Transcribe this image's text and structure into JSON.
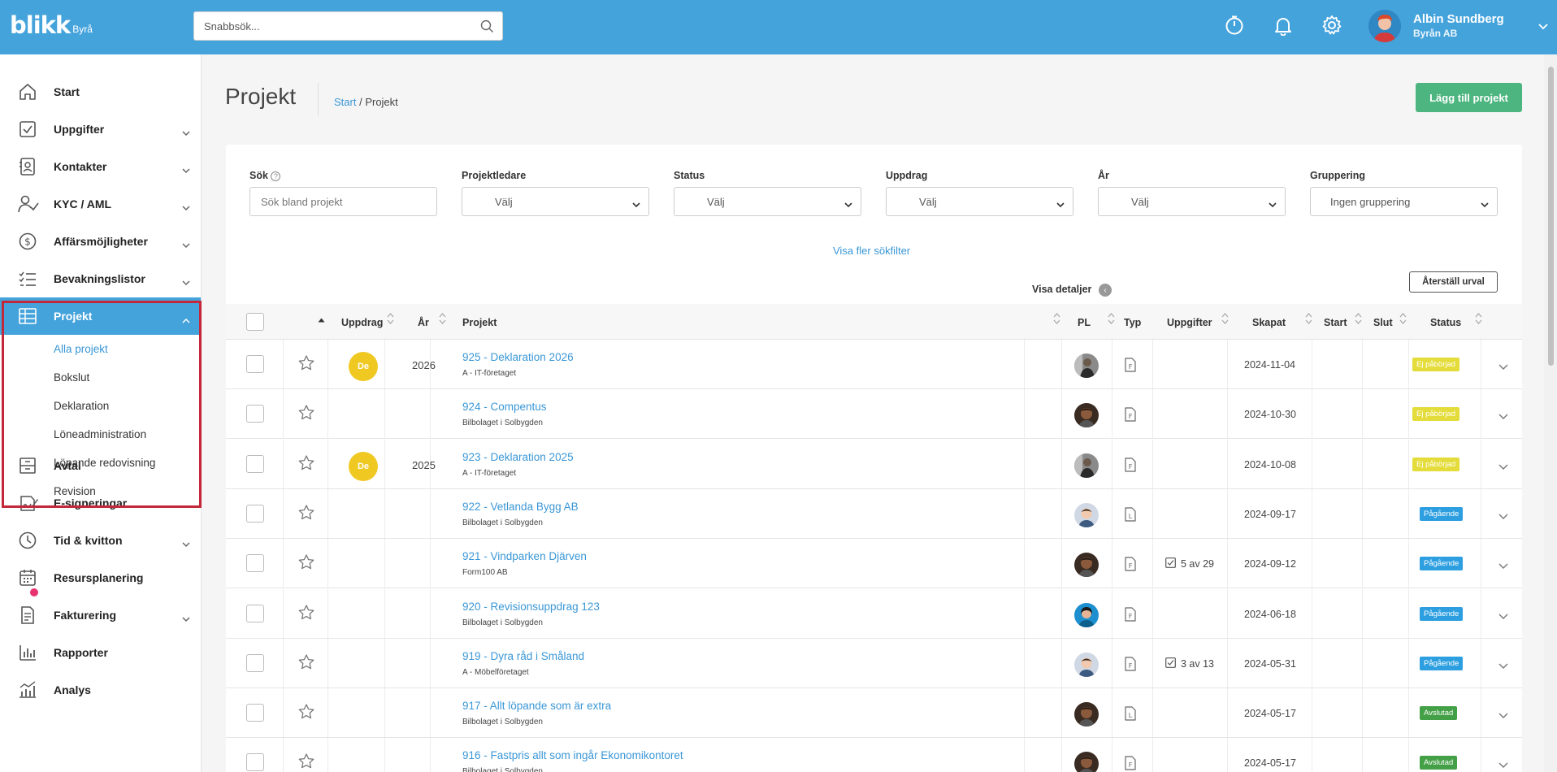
{
  "app": {
    "logo": "blikk",
    "logo_sub": "Byrå"
  },
  "header": {
    "search_placeholder": "Snabbsök...",
    "icons": [
      "stopwatch-icon",
      "bell-icon",
      "gear-icon"
    ],
    "user_name": "Albin Sundberg",
    "user_company": "Byrån AB"
  },
  "sidebar": {
    "items": [
      {
        "label": "Start",
        "icon": "home-icon",
        "chevron": false
      },
      {
        "label": "Uppgifter",
        "icon": "checkbox-icon",
        "chevron": true
      },
      {
        "label": "Kontakter",
        "icon": "contacts-icon",
        "chevron": true
      },
      {
        "label": "KYC / AML",
        "icon": "user-check-icon",
        "chevron": true
      },
      {
        "label": "Affärsmöjligheter",
        "icon": "dollar-icon",
        "chevron": true
      },
      {
        "label": "Bevakningslistor",
        "icon": "checklist-icon",
        "chevron": true
      },
      {
        "label": "Projekt",
        "icon": "table-icon",
        "chevron": true,
        "active": true
      },
      {
        "label": "Avtal",
        "icon": "archive-icon",
        "chevron": false
      },
      {
        "label": "E-signeringar",
        "icon": "signature-icon",
        "chevron": false
      },
      {
        "label": "Tid & kvitton",
        "icon": "clock-icon",
        "chevron": true
      },
      {
        "label": "Resursplanering",
        "icon": "calendar-icon",
        "chevron": false
      },
      {
        "label": "Fakturering",
        "icon": "invoice-icon",
        "chevron": true
      },
      {
        "label": "Rapporter",
        "icon": "bar-chart-icon",
        "chevron": false
      },
      {
        "label": "Analys",
        "icon": "analytics-icon",
        "chevron": false
      }
    ],
    "projekt_sub": [
      "Alla projekt",
      "Bokslut",
      "Deklaration",
      "Löneadministration",
      "Löpande redovisning",
      "Revision"
    ]
  },
  "page": {
    "title": "Projekt",
    "breadcrumb_link": "Start",
    "breadcrumb_sep": " / ",
    "breadcrumb_current": "Projekt",
    "add_button": "Lägg till projekt"
  },
  "filters": {
    "search_label": "Sök",
    "search_placeholder": "Sök bland projekt",
    "projektledare_label": "Projektledare",
    "projektledare_value": "Välj",
    "status_label": "Status",
    "status_value": "Välj",
    "uppdrag_label": "Uppdrag",
    "uppdrag_value": "Välj",
    "ar_label": "År",
    "ar_value": "Välj",
    "gruppering_label": "Gruppering",
    "gruppering_value": "Ingen gruppering",
    "more_filters": "Visa fler sökfilter",
    "show_details": "Visa detaljer",
    "reset": "Återställ urval"
  },
  "table": {
    "headers": {
      "uppdrag": "Uppdrag",
      "ar": "År",
      "projekt": "Projekt",
      "pl": "PL",
      "typ": "Typ",
      "uppgifter": "Uppgifter",
      "skapat": "Skapat",
      "start": "Start",
      "slut": "Slut",
      "status": "Status"
    },
    "rows": [
      {
        "uppdrag": "De",
        "year": "2026",
        "name": "925 - Deklaration 2026",
        "client": "A - IT-företaget",
        "typ": "F",
        "tasks": "",
        "created": "2024-11-04",
        "status": "Ej påbörjad",
        "status_type": "notstarted",
        "pl": "pl-a"
      },
      {
        "uppdrag": "",
        "year": "",
        "name": "924 - Compentus",
        "client": "Bilbolaget i Solbygden",
        "typ": "F",
        "tasks": "",
        "created": "2024-10-30",
        "status": "Ej påbörjad",
        "status_type": "notstarted",
        "pl": "pl-b"
      },
      {
        "uppdrag": "De",
        "year": "2025",
        "name": "923 - Deklaration 2025",
        "client": "A - IT-företaget",
        "typ": "F",
        "tasks": "",
        "created": "2024-10-08",
        "status": "Ej påbörjad",
        "status_type": "notstarted",
        "pl": "pl-a"
      },
      {
        "uppdrag": "",
        "year": "",
        "name": "922 - Vetlanda Bygg AB",
        "client": "Bilbolaget i Solbygden",
        "typ": "L",
        "tasks": "",
        "created": "2024-09-17",
        "status": "Pågående",
        "status_type": "ongoing",
        "pl": "pl-c"
      },
      {
        "uppdrag": "",
        "year": "",
        "name": "921 - Vindparken Djärven",
        "client": "Form100 AB",
        "typ": "F",
        "tasks": "5 av 29",
        "created": "2024-09-12",
        "status": "Pågående",
        "status_type": "ongoing",
        "pl": "pl-b"
      },
      {
        "uppdrag": "",
        "year": "",
        "name": "920 - Revisionsuppdrag 123",
        "client": "Bilbolaget i Solbygden",
        "typ": "F",
        "tasks": "",
        "created": "2024-06-18",
        "status": "Pågående",
        "status_type": "ongoing",
        "pl": "pl-d"
      },
      {
        "uppdrag": "",
        "year": "",
        "name": "919 - Dyra råd i Småland",
        "client": "A - Möbelföretaget",
        "typ": "F",
        "tasks": "3 av 13",
        "created": "2024-05-31",
        "status": "Pågående",
        "status_type": "ongoing",
        "pl": "pl-c"
      },
      {
        "uppdrag": "",
        "year": "",
        "name": "917 - Allt löpande som är extra",
        "client": "Bilbolaget i Solbygden",
        "typ": "L",
        "tasks": "",
        "created": "2024-05-17",
        "status": "Avslutad",
        "status_type": "done",
        "pl": "pl-b"
      },
      {
        "uppdrag": "",
        "year": "",
        "name": "916 - Fastpris allt som ingår Ekonomikontoret",
        "client": "Bilbolaget i Solbygden",
        "typ": "F",
        "tasks": "",
        "created": "2024-05-17",
        "status": "Avslutad",
        "status_type": "done",
        "pl": "pl-b"
      }
    ]
  },
  "colors": {
    "brand": "#45a3dc",
    "add_button": "#4db57f",
    "sidebar_highlight": "#c3283a",
    "notstarted_bg": "#e4dc3a",
    "ongoing_bg": "#2d9fe0",
    "done_bg": "#44a047",
    "uppdrag_badge": "#f0c822"
  }
}
